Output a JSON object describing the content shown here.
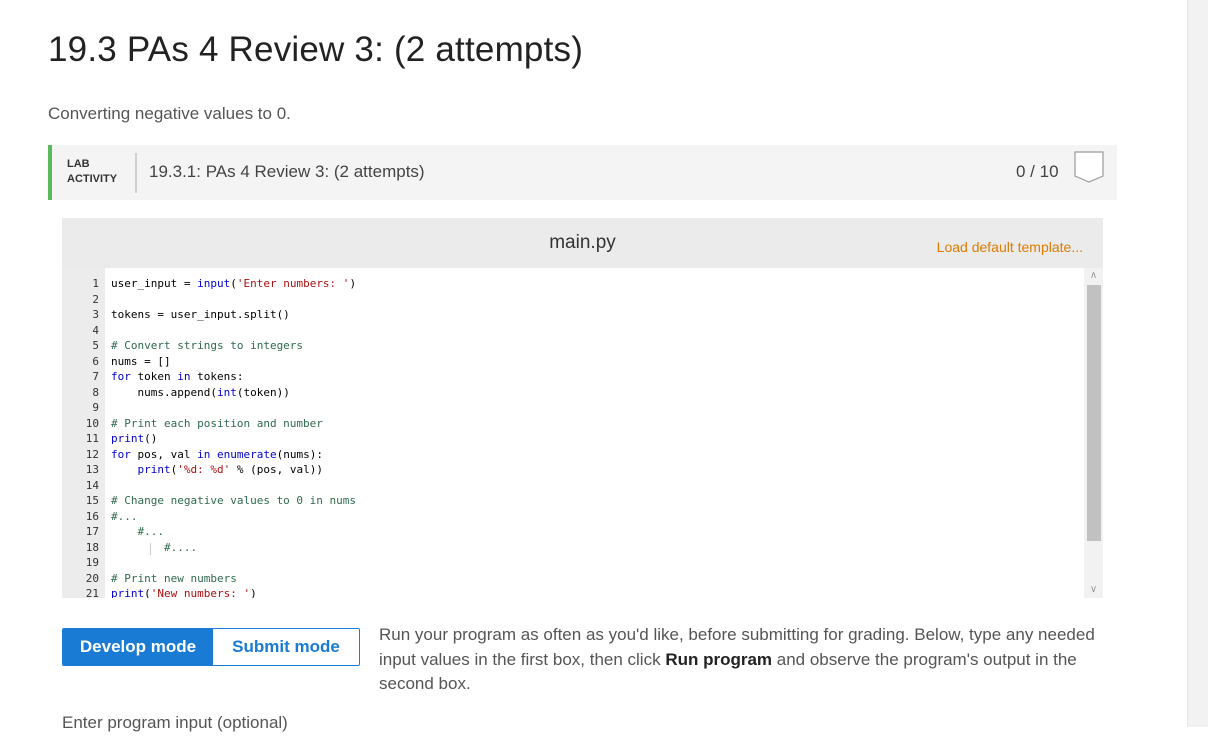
{
  "page": {
    "title": "19.3 PAs 4 Review 3: (2 attempts)",
    "subtitle": "Converting negative values to 0."
  },
  "lab": {
    "tag_line1": "LAB",
    "tag_line2": "ACTIVITY",
    "title": "19.3.1: PAs 4 Review 3: (2 attempts)",
    "score": "0 / 10",
    "accent_color": "#5cb85c",
    "score_badge_icon": "empty-badge-icon"
  },
  "editor": {
    "file_name": "main.py",
    "load_template_label": "Load default template...",
    "lines": [
      {
        "n": "1",
        "text": "user_input = input('Enter numbers: ')"
      },
      {
        "n": "2",
        "text": ""
      },
      {
        "n": "3",
        "text": "tokens = user_input.split()"
      },
      {
        "n": "4",
        "text": ""
      },
      {
        "n": "5",
        "text": "# Convert strings to integers"
      },
      {
        "n": "6",
        "text": "nums = []"
      },
      {
        "n": "7",
        "text": "for token in tokens:"
      },
      {
        "n": "8",
        "text": "    nums.append(int(token))"
      },
      {
        "n": "9",
        "text": ""
      },
      {
        "n": "10",
        "text": "# Print each position and number"
      },
      {
        "n": "11",
        "text": "print()"
      },
      {
        "n": "12",
        "text": "for pos, val in enumerate(nums):"
      },
      {
        "n": "13",
        "text": "    print('%d: %d' % (pos, val))"
      },
      {
        "n": "14",
        "text": ""
      },
      {
        "n": "15",
        "text": "# Change negative values to 0 in nums"
      },
      {
        "n": "16",
        "text": "#..."
      },
      {
        "n": "17",
        "text": "    #..."
      },
      {
        "n": "18",
        "text": "        #...."
      },
      {
        "n": "19",
        "text": ""
      },
      {
        "n": "20",
        "text": "# Print new numbers"
      },
      {
        "n": "21",
        "text": "print('New numbers: ')"
      }
    ]
  },
  "modes": {
    "develop_label": "Develop mode",
    "submit_label": "Submit mode",
    "active": "Develop mode",
    "active_color": "#1a7bd4"
  },
  "instructions": {
    "part1": "Run your program as often as you'd like, before submitting for grading. Below, type any needed input values in the first box, then click ",
    "run_label": "Run program",
    "part2": " and observe the program's output in the second box."
  },
  "input_section": {
    "label": "Enter program input (optional)"
  }
}
